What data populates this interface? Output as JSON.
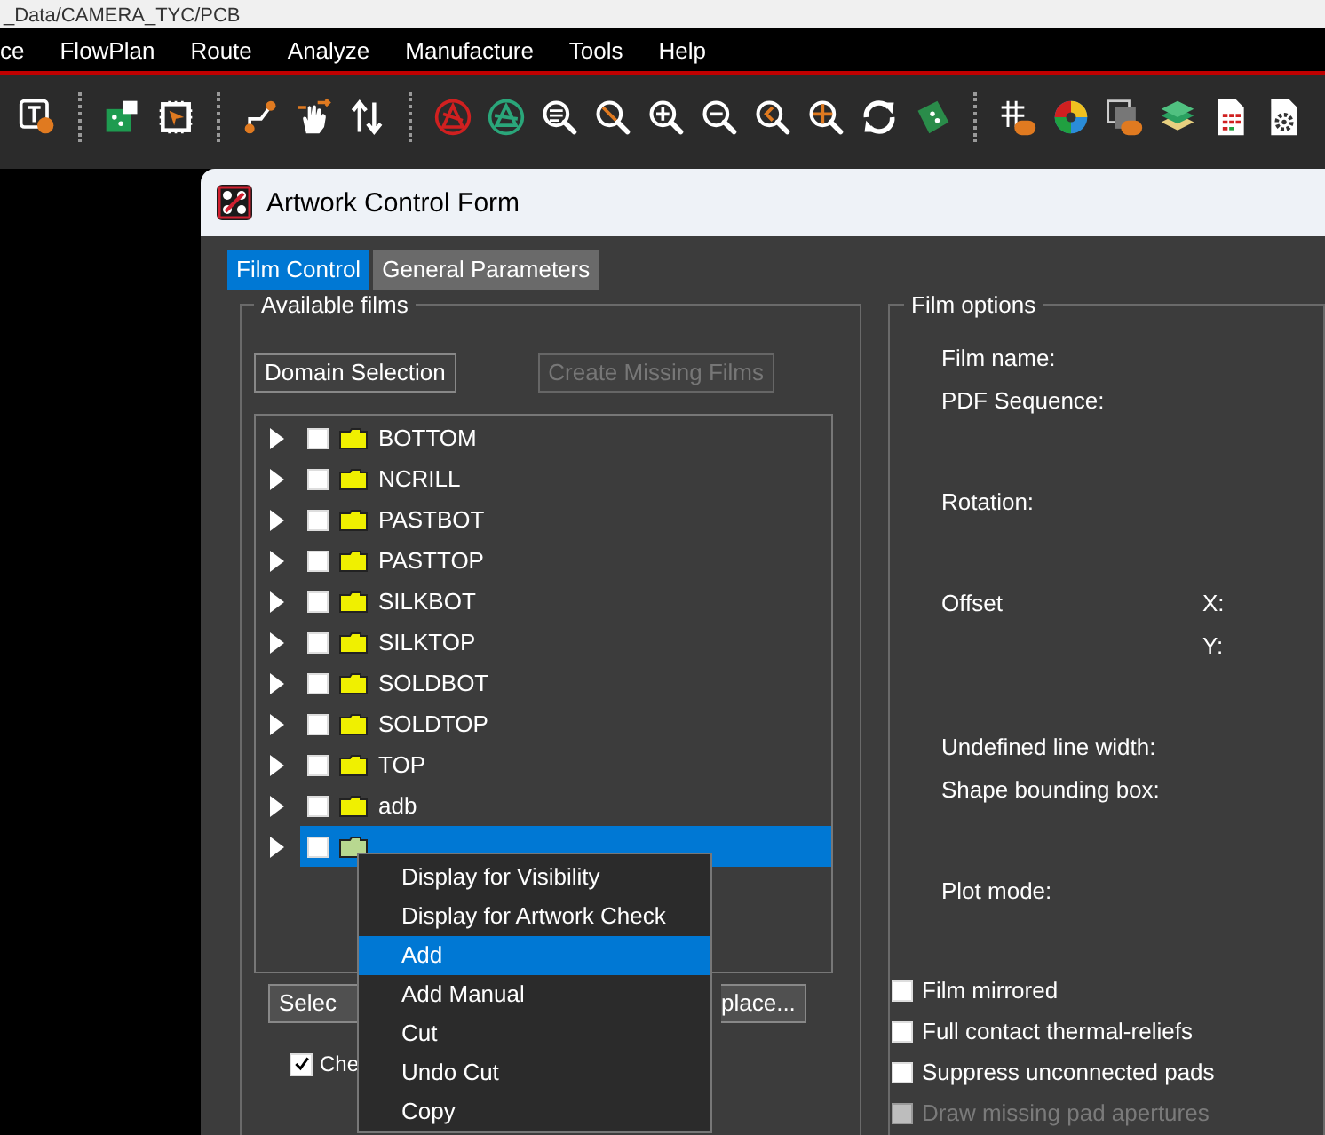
{
  "title_strip": {
    "text": "_Data/CAMERA_TYC/PCB"
  },
  "menu_bar": [
    {
      "label": "ce"
    },
    {
      "label": "FlowPlan"
    },
    {
      "label": "Route"
    },
    {
      "label": "Analyze"
    },
    {
      "label": "Manufacture"
    },
    {
      "label": "Tools"
    },
    {
      "label": "Help"
    }
  ],
  "dialog": {
    "title": "Artwork Control Form",
    "tabs": [
      {
        "label": "Film Control",
        "selected": true
      },
      {
        "label": "General Parameters",
        "selected": false
      }
    ],
    "available_films": {
      "legend": "Available films",
      "buttons": [
        {
          "label": "Domain Selection",
          "disabled": false
        },
        {
          "label": "Create Missing Films",
          "disabled": true
        }
      ],
      "films": [
        {
          "name": "BOTTOM",
          "checked": false,
          "expanded": false,
          "selected": false
        },
        {
          "name": "NCRILL",
          "checked": false,
          "expanded": false,
          "selected": false
        },
        {
          "name": "PASTBOT",
          "checked": false,
          "expanded": false,
          "selected": false
        },
        {
          "name": "PASTTOP",
          "checked": false,
          "expanded": false,
          "selected": false
        },
        {
          "name": "SILKBOT",
          "checked": false,
          "expanded": false,
          "selected": false
        },
        {
          "name": "SILKTOP",
          "checked": false,
          "expanded": false,
          "selected": false
        },
        {
          "name": "SOLDBOT",
          "checked": false,
          "expanded": false,
          "selected": false
        },
        {
          "name": "SOLDTOP",
          "checked": false,
          "expanded": false,
          "selected": false
        },
        {
          "name": "TOP",
          "checked": false,
          "expanded": false,
          "selected": false
        },
        {
          "name": "adb",
          "checked": false,
          "expanded": false,
          "selected": false
        },
        {
          "checked": false,
          "expanded": false,
          "selected": true
        }
      ],
      "lower_buttons": [
        "Selec",
        "place..."
      ],
      "option": {
        "label": "Che",
        "checked": true
      }
    },
    "film_options": {
      "legend": "Film options",
      "groups": [
        [
          {
            "label": "Film name:"
          },
          {
            "label": "PDF Sequence:"
          }
        ],
        [
          {
            "label": "Rotation:"
          }
        ],
        [
          {
            "label": "Offset",
            "sublabel": "X:"
          },
          {
            "sublabel": "Y:"
          }
        ],
        [
          {
            "label": "Undefined line width:"
          },
          {
            "label": "Shape bounding box:"
          }
        ],
        [
          {
            "label": "Plot mode:"
          }
        ]
      ],
      "checkboxes": [
        {
          "label": "Film mirrored",
          "checked": false,
          "disabled": false
        },
        {
          "label": "Full contact thermal-reliefs",
          "checked": false,
          "disabled": false
        },
        {
          "label": "Suppress unconnected pads",
          "checked": false,
          "disabled": false
        },
        {
          "label": "Draw missing pad apertures",
          "checked": false,
          "disabled": true
        }
      ]
    }
  },
  "context_menu": [
    {
      "label": "Display for Visibility",
      "selected": false
    },
    {
      "label": "Display for Artwork Check",
      "selected": false
    },
    {
      "label": "Add",
      "selected": true
    },
    {
      "label": "Add Manual",
      "selected": false
    },
    {
      "label": "Cut",
      "selected": false
    },
    {
      "label": "Undo Cut",
      "selected": false
    },
    {
      "label": "Copy",
      "selected": false
    }
  ]
}
